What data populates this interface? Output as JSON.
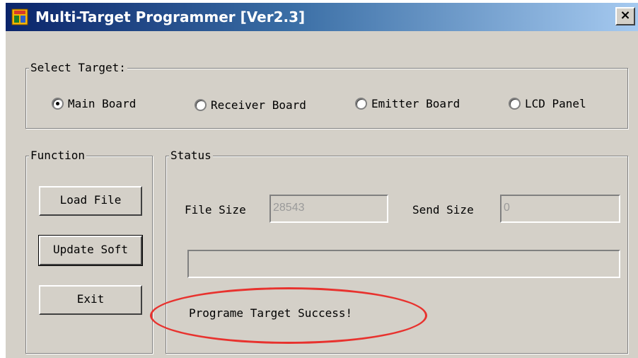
{
  "window": {
    "title": "Multi-Target Programmer [Ver2.3]",
    "close_symbol": "×"
  },
  "select_target": {
    "legend": "Select Target:",
    "options": [
      {
        "label": "Main Board",
        "checked": true
      },
      {
        "label": "Receiver Board",
        "checked": false
      },
      {
        "label": "Emitter Board",
        "checked": false
      },
      {
        "label": "LCD Panel",
        "checked": false
      }
    ]
  },
  "function": {
    "legend": "Function",
    "buttons": {
      "load": "Load File",
      "update": "Update Soft",
      "exit": "Exit"
    }
  },
  "status": {
    "legend": "Status",
    "file_size_label": "File Size",
    "file_size_value": "28543",
    "send_size_label": "Send Size",
    "send_size_value": "0",
    "progress": 0,
    "message": "Programe Target Success!"
  },
  "colors": {
    "annotation": "#e8322e",
    "dialog_bg": "#d4d0c8",
    "title_bar": "#0a246a"
  }
}
